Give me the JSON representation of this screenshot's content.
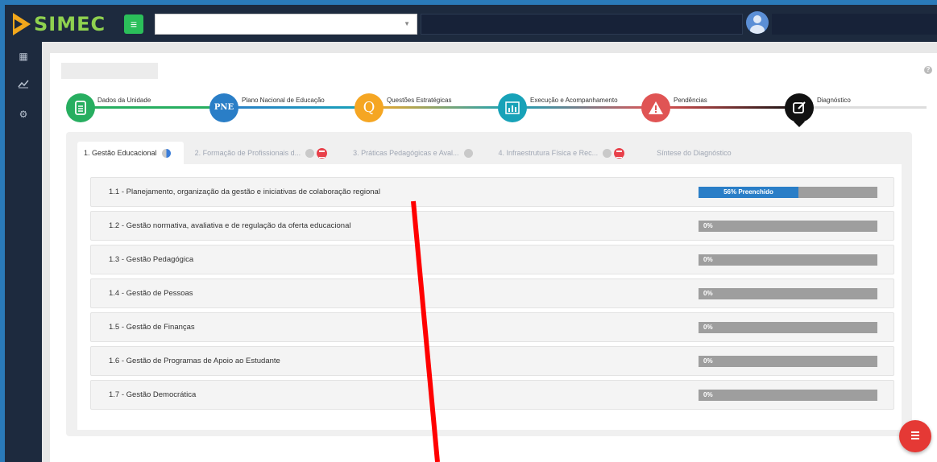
{
  "header": {
    "brand": "SIMEC",
    "select_value": "",
    "menu_icon": "hamburger-icon"
  },
  "sidebar": {
    "items": [
      {
        "icon": "dashboard-grid-icon"
      },
      {
        "icon": "line-chart-icon"
      },
      {
        "icon": "settings-gears-icon"
      }
    ]
  },
  "stepper": {
    "steps": [
      {
        "label": "Dados da Unidade",
        "icon": "document-icon",
        "color": "#27ae60"
      },
      {
        "label": "Plano Nacional de Educação",
        "icon_text": "PNE",
        "color": "#2a7ec7"
      },
      {
        "label": "Questões Estratégicas",
        "icon_text": "Q",
        "color": "#f5a623"
      },
      {
        "label": "Execução e Acompanhamento",
        "icon": "bar-chart-icon",
        "color": "#17a2b8"
      },
      {
        "label": "Pendências",
        "icon": "warning-icon",
        "color": "#e05454"
      },
      {
        "label": "Diagnóstico",
        "icon": "edit-icon",
        "color": "#111111"
      }
    ]
  },
  "tabs": [
    {
      "label": "1. Gestão Educacional",
      "active": true
    },
    {
      "label": "2. Formação de Profissionais d...",
      "active": false
    },
    {
      "label": "3. Práticas Pedagógicas e Aval...",
      "active": false
    },
    {
      "label": "4. Infraestrutura Física e Rec...",
      "active": false
    },
    {
      "label": "Síntese do Diagnóstico",
      "active": false
    }
  ],
  "sections": [
    {
      "title": "1.1 - Planejamento, organização da gestão e iniciativas de colaboração regional",
      "progress_label": "56% Preenchido",
      "progress": 56
    },
    {
      "title": "1.2 - Gestão normativa, avaliativa e de regulação da oferta educacional",
      "progress_label": "0%",
      "progress": 0
    },
    {
      "title": "1.3 - Gestão Pedagógica",
      "progress_label": "0%",
      "progress": 0
    },
    {
      "title": "1.4 - Gestão de Pessoas",
      "progress_label": "0%",
      "progress": 0
    },
    {
      "title": "1.5 - Gestão de Finanças",
      "progress_label": "0%",
      "progress": 0
    },
    {
      "title": "1.6 - Gestão de Programas de Apoio ao Estudante",
      "progress_label": "0%",
      "progress": 0
    },
    {
      "title": "1.7 - Gestão Democrática",
      "progress_label": "0%",
      "progress": 0
    }
  ],
  "help_icon": "?",
  "fab_icon": "list-icon"
}
